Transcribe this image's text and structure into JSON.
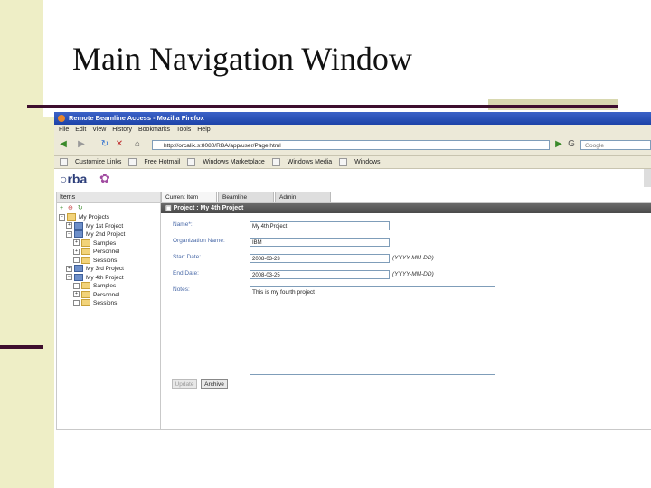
{
  "slide": {
    "title": "Main Navigation Window"
  },
  "browser": {
    "window_title": "Remote Beamline Access - Mozilla Firefox",
    "menu": [
      "File",
      "Edit",
      "View",
      "History",
      "Bookmarks",
      "Tools",
      "Help"
    ],
    "url": "http://orcalix.s:8080/RBA/app/user/Page.html",
    "search_placeholder": "Google",
    "bookmarks": [
      "Customize Links",
      "Free Hotmail",
      "Windows Marketplace",
      "Windows Media",
      "Windows"
    ]
  },
  "app": {
    "logo_text": "rba",
    "tabs": [
      "Current Item",
      "Beamline",
      "Admin"
    ],
    "items_panel": {
      "title": "Items",
      "tree": [
        {
          "label": "My Projects",
          "level": 0,
          "expander": "−",
          "icon": "folder"
        },
        {
          "label": "My 1st Project",
          "level": 1,
          "expander": "+",
          "icon": "project"
        },
        {
          "label": "My 2nd Project",
          "level": 1,
          "expander": "−",
          "icon": "project"
        },
        {
          "label": "Samples",
          "level": 2,
          "expander": "+",
          "icon": "folder"
        },
        {
          "label": "Personnel",
          "level": 2,
          "expander": "+",
          "icon": "folder"
        },
        {
          "label": "Sessions",
          "level": 2,
          "expander": "",
          "icon": "folder"
        },
        {
          "label": "My 3rd Project",
          "level": 1,
          "expander": "+",
          "icon": "project"
        },
        {
          "label": "My 4th Project",
          "level": 1,
          "expander": "−",
          "icon": "project"
        },
        {
          "label": "Samples",
          "level": 2,
          "expander": "",
          "icon": "folder"
        },
        {
          "label": "Personnel",
          "level": 2,
          "expander": "+",
          "icon": "folder"
        },
        {
          "label": "Sessions",
          "level": 2,
          "expander": "",
          "icon": "folder"
        }
      ]
    },
    "project": {
      "header": "Project : My 4th Project",
      "name_label": "Name*:",
      "name_value": "My 4th Project",
      "org_label": "Organization Name:",
      "org_value": "IBM",
      "start_label": "Start Date:",
      "start_value": "2008-03-23",
      "end_label": "End Date:",
      "end_value": "2008-03-25",
      "date_hint": "(YYYY-MM-DD)",
      "notes_label": "Notes:",
      "notes_value": "This is my fourth project",
      "update_label": "Update",
      "archive_label": "Archive"
    }
  }
}
